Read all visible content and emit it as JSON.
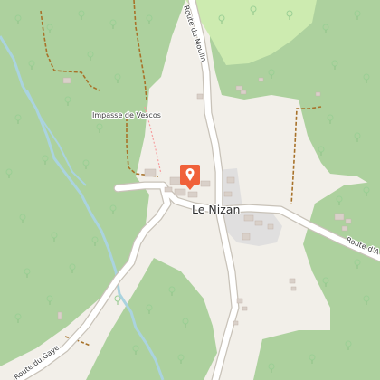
{
  "map": {
    "place_label": "Le Nizan",
    "road_labels": {
      "route_du_moulin": "Route du Moulin",
      "impasse_de_vescos": "Impasse de Vescos",
      "route_du_gaye": "Route du Gaye",
      "route_d_a": "Route d'A"
    },
    "marker_icon": "map-pin-icon",
    "colors": {
      "forest": "#add19e",
      "meadow": "#cdebb0",
      "residential": "#e0dfdf",
      "background": "#f2efe9",
      "road": "#ffffff",
      "road_casing": "#c8c2b8",
      "track": "#a8722a",
      "stream": "#aad3df",
      "marker": "#f0613a"
    }
  }
}
